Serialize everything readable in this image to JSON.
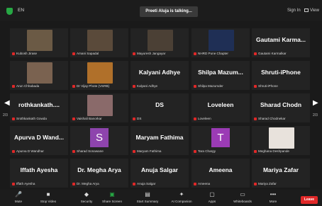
{
  "topbar": {
    "language": "EN",
    "talking": "Preeti Aluja is talking...",
    "sign_in": "Sign In",
    "view": "View"
  },
  "tiles": [
    {
      "label": "Kubosh Jirase",
      "big": "",
      "avatar_letter": "",
      "video": "#6b5a45"
    },
    {
      "label": "Amani Sapadal",
      "big": "",
      "avatar_letter": "",
      "video": "#5a4a3a"
    },
    {
      "label": "Mayuresh Jangayar",
      "big": "",
      "avatar_letter": "",
      "video": "#4b4035"
    },
    {
      "label": "NHRD Pune Chapter",
      "big": "",
      "avatar_letter": "",
      "video": "#1f2f55"
    },
    {
      "label": "Gautami Karmalkar",
      "big": "Gautami Karma...",
      "avatar_letter": "",
      "video": ""
    },
    {
      "label": "Arun Chhabada",
      "big": "",
      "avatar_letter": "",
      "video": "#7a6250"
    },
    {
      "label": "Dr Vijay Phote (VSRB)",
      "big": "",
      "avatar_letter": "",
      "video": "#b0702a"
    },
    {
      "label": "Kalyani Adhye",
      "big": "Kalyani Adhye",
      "avatar_letter": "",
      "video": ""
    },
    {
      "label": "Shilpa Mazumder",
      "big": "Shilpa Mazum...",
      "avatar_letter": "",
      "video": ""
    },
    {
      "label": "Shruti-iPhone",
      "big": "Shruti-iPhone",
      "avatar_letter": "",
      "video": ""
    },
    {
      "label": "Srothkankath Gowda",
      "big": "rothkankath....",
      "avatar_letter": "",
      "video": ""
    },
    {
      "label": "Vaishali Banorkar",
      "big": "",
      "avatar_letter": "",
      "video": "#8a6a6a"
    },
    {
      "label": "DS",
      "big": "DS",
      "avatar_letter": "",
      "video": ""
    },
    {
      "label": "Loveleen",
      "big": "Loveleen",
      "avatar_letter": "",
      "video": ""
    },
    {
      "label": "Sharad Chodnekar",
      "big": "Sharad Chodn",
      "avatar_letter": "",
      "video": ""
    },
    {
      "label": "Apurva D Wandhar",
      "big": "Apurva D Wand...",
      "avatar_letter": "",
      "video": ""
    },
    {
      "label": "Sharad Sonawane",
      "big": "",
      "avatar_letter": "S",
      "video": "#8e44ad"
    },
    {
      "label": "Maryam Fathima",
      "big": "Maryam Fathima",
      "avatar_letter": "",
      "video": ""
    },
    {
      "label": "Tara Chargy",
      "big": "",
      "avatar_letter": "T",
      "video": "#9b3bb5"
    },
    {
      "label": "Meghana Deshpande",
      "big": "",
      "avatar_letter": "",
      "video": "#e8e2dc"
    },
    {
      "label": "Iffath Ayesha",
      "big": "Iffath Ayesha",
      "avatar_letter": "",
      "video": ""
    },
    {
      "label": "Dr. Megha Arya",
      "big": "Dr. Megha Arya",
      "avatar_letter": "",
      "video": ""
    },
    {
      "label": "Anuja Salgar",
      "big": "Anuja Salgar",
      "avatar_letter": "",
      "video": ""
    },
    {
      "label": "Ameena",
      "big": "Ameena",
      "avatar_letter": "",
      "video": ""
    },
    {
      "label": "Mariya Zafar",
      "big": "Mariya Zafar",
      "avatar_letter": "",
      "video": ""
    }
  ],
  "pager": {
    "left": "2/3",
    "right": "2/3"
  },
  "toolbar": {
    "mute": "Mute",
    "stop_video": "Stop Video",
    "security": "Security",
    "share_screen": "Share Screen",
    "start_summary": "Start Summary",
    "ai_companion": "AI Companion",
    "apps": "Apps",
    "whiteboards": "Whiteboards",
    "more": "More",
    "leave": "Leave"
  },
  "colors": {
    "accent_green": "#27a844",
    "leave_red": "#e02828",
    "mute_red": "#e02828"
  }
}
